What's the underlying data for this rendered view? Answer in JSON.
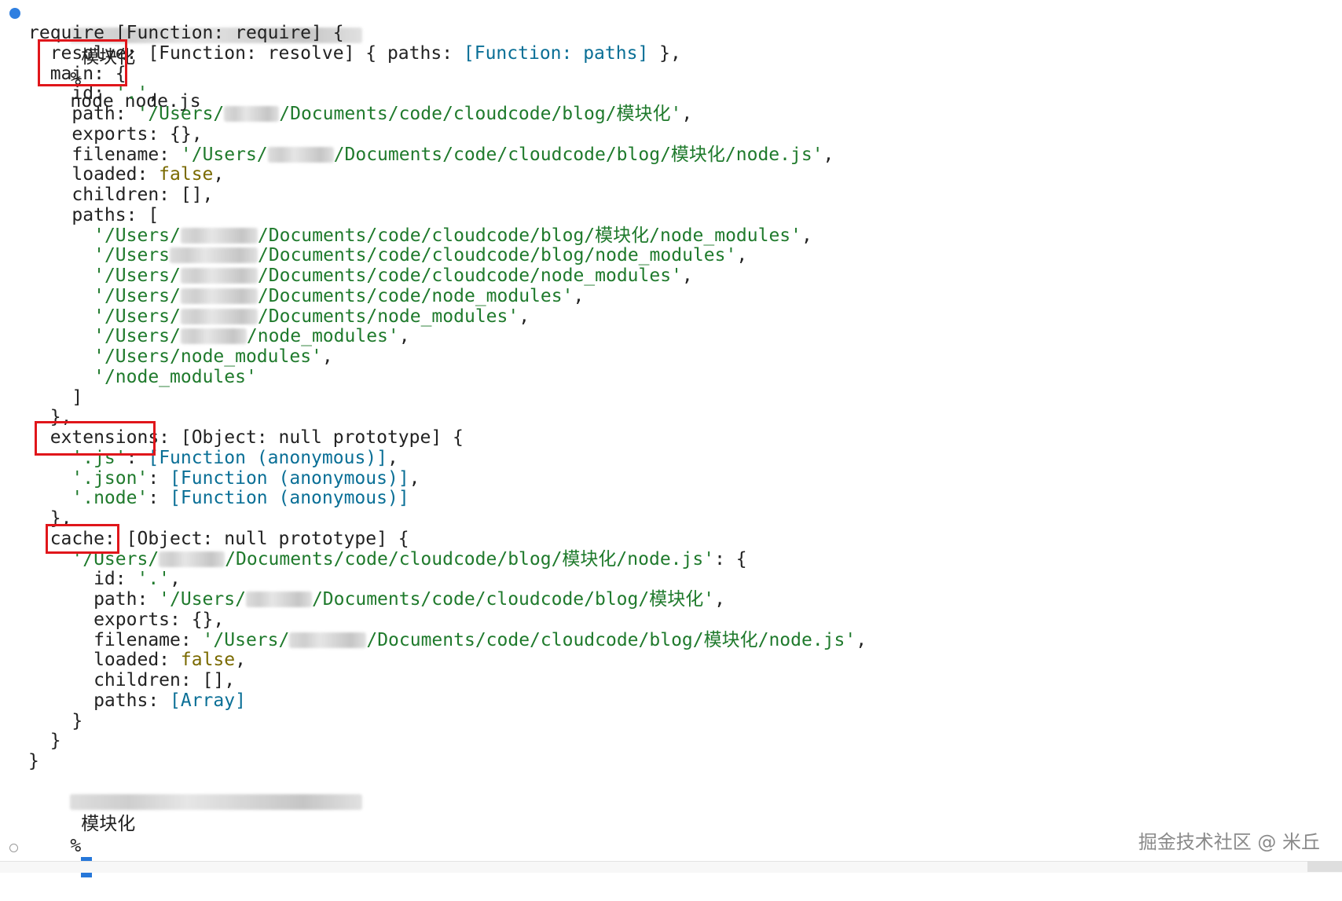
{
  "terminal": {
    "prompt_dir": "模块化",
    "prompt_symbol": "%",
    "command": "node node.js",
    "lines": [
      [
        {
          "t": "require [Function: require] {"
        }
      ],
      [
        {
          "t": "  resolve: [Function: resolve] { paths: "
        },
        {
          "t": "[Function: paths]",
          "c": "f"
        },
        {
          "t": " },"
        }
      ],
      [
        {
          "t": "  main: {"
        }
      ],
      [
        {
          "t": "    id: "
        },
        {
          "t": "'.'",
          "c": "s"
        },
        {
          "t": ","
        }
      ],
      [
        {
          "t": "    path: "
        },
        {
          "t": "'/Users/",
          "c": "s"
        },
        {
          "blur": 5
        },
        {
          "t": "/Documents/code/cloudcode/blog/模块化'",
          "c": "s"
        },
        {
          "t": ","
        }
      ],
      [
        {
          "t": "    exports: {},"
        }
      ],
      [
        {
          "t": "    filename: "
        },
        {
          "t": "'/Users/",
          "c": "s"
        },
        {
          "blur": 6
        },
        {
          "t": "/Documents/code/cloudcode/blog/模块化/node.js'",
          "c": "s"
        },
        {
          "t": ","
        }
      ],
      [
        {
          "t": "    loaded: "
        },
        {
          "t": "false",
          "c": "b"
        },
        {
          "t": ","
        }
      ],
      [
        {
          "t": "    children: [],"
        }
      ],
      [
        {
          "t": "    paths: ["
        }
      ],
      [
        {
          "t": "      "
        },
        {
          "t": "'/Users/",
          "c": "s"
        },
        {
          "blur": 7
        },
        {
          "t": "/Documents/code/cloudcode/blog/模块化/node_modules'",
          "c": "s"
        },
        {
          "t": ","
        }
      ],
      [
        {
          "t": "      "
        },
        {
          "t": "'/Users",
          "c": "s"
        },
        {
          "blur": 8
        },
        {
          "t": "/Documents/code/cloudcode/blog/node_modules'",
          "c": "s"
        },
        {
          "t": ","
        }
      ],
      [
        {
          "t": "      "
        },
        {
          "t": "'/Users/",
          "c": "s"
        },
        {
          "blur": 7
        },
        {
          "t": "/Documents/code/cloudcode/node_modules'",
          "c": "s"
        },
        {
          "t": ","
        }
      ],
      [
        {
          "t": "      "
        },
        {
          "t": "'/Users/",
          "c": "s"
        },
        {
          "blur": 7
        },
        {
          "t": "/Documents/code/node_modules'",
          "c": "s"
        },
        {
          "t": ","
        }
      ],
      [
        {
          "t": "      "
        },
        {
          "t": "'/Users/",
          "c": "s"
        },
        {
          "blur": 7
        },
        {
          "t": "/Documents/node_modules'",
          "c": "s"
        },
        {
          "t": ","
        }
      ],
      [
        {
          "t": "      "
        },
        {
          "t": "'/Users/",
          "c": "s"
        },
        {
          "blur": 6
        },
        {
          "t": "/node_modules'",
          "c": "s"
        },
        {
          "t": ","
        }
      ],
      [
        {
          "t": "      "
        },
        {
          "t": "'/Users/node_modules'",
          "c": "s"
        },
        {
          "t": ","
        }
      ],
      [
        {
          "t": "      "
        },
        {
          "t": "'/node_modules'",
          "c": "s"
        }
      ],
      [
        {
          "t": "    ]"
        }
      ],
      [
        {
          "t": "  },"
        }
      ],
      [
        {
          "t": "  extensions: [Object: null prototype] {"
        }
      ],
      [
        {
          "t": "    "
        },
        {
          "t": "'.js'",
          "c": "s"
        },
        {
          "t": ": "
        },
        {
          "t": "[Function (anonymous)]",
          "c": "f"
        },
        {
          "t": ","
        }
      ],
      [
        {
          "t": "    "
        },
        {
          "t": "'.json'",
          "c": "s"
        },
        {
          "t": ": "
        },
        {
          "t": "[Function (anonymous)]",
          "c": "f"
        },
        {
          "t": ","
        }
      ],
      [
        {
          "t": "    "
        },
        {
          "t": "'.node'",
          "c": "s"
        },
        {
          "t": ": "
        },
        {
          "t": "[Function (anonymous)]",
          "c": "f"
        }
      ],
      [
        {
          "t": "  },"
        }
      ],
      [
        {
          "t": "  cache: [Object: null prototype] {"
        }
      ],
      [
        {
          "t": "    "
        },
        {
          "t": "'/Users/",
          "c": "s"
        },
        {
          "blur": 6
        },
        {
          "t": "/Documents/code/cloudcode/blog/模块化/node.js'",
          "c": "s"
        },
        {
          "t": ": {"
        }
      ],
      [
        {
          "t": "      id: "
        },
        {
          "t": "'.'",
          "c": "s"
        },
        {
          "t": ","
        }
      ],
      [
        {
          "t": "      path: "
        },
        {
          "t": "'/Users/",
          "c": "s"
        },
        {
          "blur": 6
        },
        {
          "t": "/Documents/code/cloudcode/blog/模块化'",
          "c": "s"
        },
        {
          "t": ","
        }
      ],
      [
        {
          "t": "      exports: {},"
        }
      ],
      [
        {
          "t": "      filename: "
        },
        {
          "t": "'/Users/",
          "c": "s"
        },
        {
          "blur": 7
        },
        {
          "t": "/Documents/code/cloudcode/blog/模块化/node.js'",
          "c": "s"
        },
        {
          "t": ","
        }
      ],
      [
        {
          "t": "      loaded: "
        },
        {
          "t": "false",
          "c": "b"
        },
        {
          "t": ","
        }
      ],
      [
        {
          "t": "      children: [],"
        }
      ],
      [
        {
          "t": "      paths: "
        },
        {
          "t": "[Array]",
          "c": "f"
        }
      ],
      [
        {
          "t": "    }"
        }
      ],
      [
        {
          "t": "  }"
        }
      ],
      [
        {
          "t": "}"
        }
      ]
    ]
  },
  "highlight_labels": [
    "resolve:",
    "main: {",
    "extensions:",
    "cache:"
  ],
  "watermark": "掘金技术社区 @ 米丘",
  "colors": {
    "string": "#1f7a2c",
    "function_ref": "#0a6f96",
    "boolean": "#7a6a00",
    "highlight_box": "#e0161b",
    "status_dot": "#2f7fe0",
    "cursor": "#2677d9"
  }
}
